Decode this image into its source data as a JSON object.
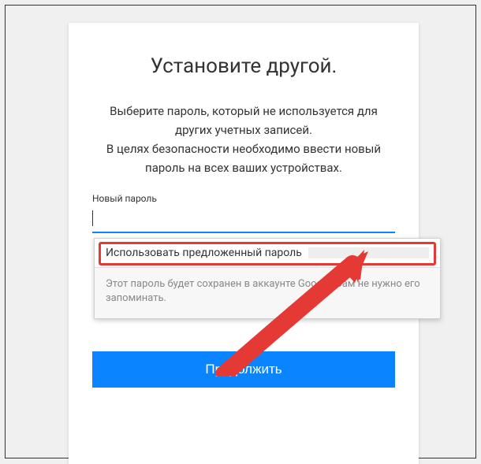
{
  "title": "Установите другой.",
  "instructions_line1": "Выберите пароль, который не используется для других учетных записей.",
  "instructions_line2": "В целях безопасности необходимо ввести новый пароль на всех ваших устройствах.",
  "field_label": "Новый пароль",
  "password_value": "",
  "continue_label": "Продолжить",
  "suggest": {
    "use_label": "Использовать предложенный пароль",
    "note": "Этот пароль будет сохранен в аккаунте Google. Вам не нужно его запоминать."
  }
}
